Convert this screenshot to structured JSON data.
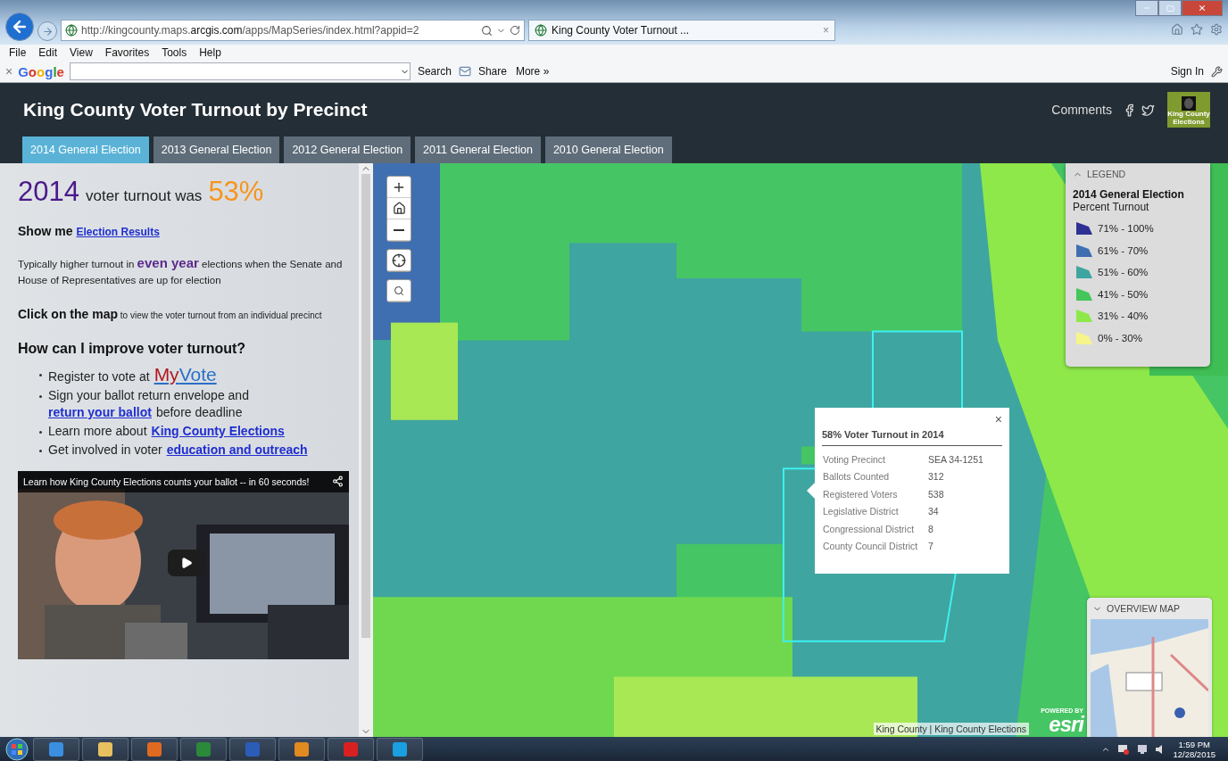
{
  "browser": {
    "url": "http://kingcounty.maps.**arcgis.com**/apps/MapSeries/index.html?appid=2",
    "tab_title": "King County Voter Turnout ...",
    "tab_close": "×",
    "menu": [
      "File",
      "Edit",
      "View",
      "Favorites",
      "Tools",
      "Help"
    ],
    "toolbar": {
      "close": "×",
      "logo": "Google",
      "search": "Search",
      "share": "Share",
      "more": "More »",
      "sign_in": "Sign In"
    }
  },
  "app": {
    "title": "King County Voter Turnout by Precinct",
    "comments": "Comments",
    "logo_text": "King County Elections",
    "tabs": [
      {
        "label": "2014 General Election",
        "selected": true
      },
      {
        "label": "2013 General Election",
        "selected": false
      },
      {
        "label": "2012 General Election",
        "selected": false
      },
      {
        "label": "2011 General Election",
        "selected": false
      },
      {
        "label": "2010 General Election",
        "selected": false
      }
    ]
  },
  "panel": {
    "headline": {
      "year": "2014",
      "middle": "voter turnout was",
      "percent": "53%"
    },
    "show_me": {
      "label": "Show me",
      "link": "Election Results"
    },
    "note_parts": [
      {
        "kind": "text",
        "text": "Typically higher turnout in "
      },
      {
        "kind": "emph",
        "text": "even year"
      },
      {
        "kind": "text",
        "text": " elections when the Senate and House of Representatives are up for election"
      }
    ],
    "click_parts": [
      {
        "kind": "strong",
        "text": "Click on the map"
      },
      {
        "kind": "small",
        "text": " to view the voter turnout from an individual precinct"
      }
    ],
    "question": "How can I improve voter turnout?",
    "items": [
      [
        {
          "kind": "text",
          "text": "Register to vote at"
        },
        {
          "kind": "brand",
          "texts": [
            "My",
            "Vote"
          ]
        }
      ],
      [
        {
          "kind": "text",
          "text": "Sign your ballot return envelope and"
        },
        {
          "kind": "link",
          "text": "return your ballot"
        },
        {
          "kind": "text",
          "text": "before deadline"
        }
      ],
      [
        {
          "kind": "text",
          "text": "Learn more about"
        },
        {
          "kind": "link",
          "text": "King County Elections"
        }
      ],
      [
        {
          "kind": "text",
          "text": "Get involved in voter"
        },
        {
          "kind": "link",
          "text": "education and outreach"
        }
      ]
    ],
    "video": {
      "title": "Learn how King County Elections counts your ballot -- in 60 seconds!"
    }
  },
  "map": {
    "legend": {
      "header": "LEGEND",
      "title": "2014 General Election",
      "subtitle": "Percent Turnout",
      "items": [
        {
          "label": "71% - 100%",
          "color": "#2e3192"
        },
        {
          "label": "61% - 70%",
          "color": "#3f6fb0"
        },
        {
          "label": "51% - 60%",
          "color": "#3fa5a0"
        },
        {
          "label": "41% - 50%",
          "color": "#44c65a"
        },
        {
          "label": "31% - 40%",
          "color": "#8ee84a"
        },
        {
          "label": "0% - 30%",
          "color": "#f5f58a"
        }
      ]
    },
    "popup": {
      "close": "×",
      "title": "58% Voter Turnout in 2014",
      "rows": [
        {
          "label": "Voting Precinct",
          "value": "SEA 34-1251"
        },
        {
          "label": "Ballots Counted",
          "value": "312"
        },
        {
          "label": "Registered Voters",
          "value": "538"
        },
        {
          "label": "Legislative District",
          "value": "34"
        },
        {
          "label": "Congressional District",
          "value": "8"
        },
        {
          "label": "County Council District",
          "value": "7"
        }
      ]
    },
    "overview": {
      "header": "OVERVIEW MAP"
    },
    "attribution": "King County | King County Elections",
    "esri": {
      "small": "POWERED BY",
      "logo": "esri"
    }
  },
  "taskbar": {
    "time": "1:59 PM",
    "date": "12/28/2015"
  }
}
